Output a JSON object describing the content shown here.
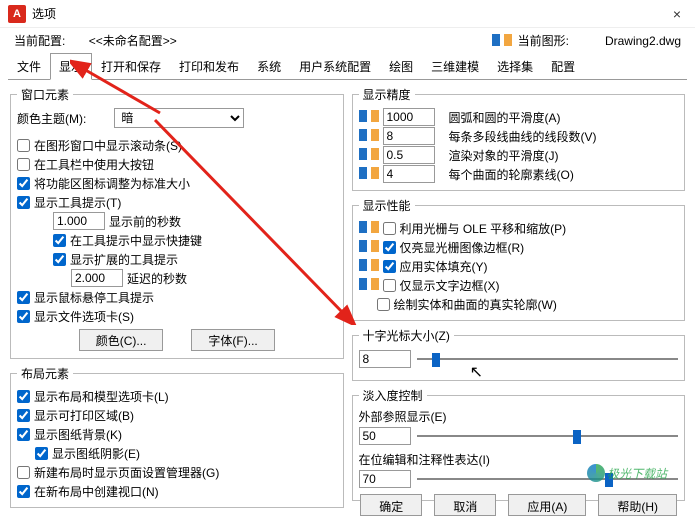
{
  "window": {
    "title": "选项",
    "close": "×"
  },
  "header": {
    "currentProfileLabel": "当前配置:",
    "currentProfileValue": "<<未命名配置>>",
    "currentDrawingLabel": "当前图形:",
    "currentDrawingValue": "Drawing2.dwg"
  },
  "tabs": [
    "文件",
    "显示",
    "打开和保存",
    "打印和发布",
    "系统",
    "用户系统配置",
    "绘图",
    "三维建模",
    "选择集",
    "配置"
  ],
  "activeTab": 1,
  "left": {
    "group1": {
      "legend": "窗口元素",
      "colorThemeLabel": "颜色主题(M):",
      "colorThemeValue": "暗",
      "items": {
        "a": "在图形窗口中显示滚动条(S)",
        "b": "在工具栏中使用大按钮",
        "c": "将功能区图标调整为标准大小",
        "d": "显示工具提示(T)",
        "d_secLabel": "显示前的秒数",
        "d_secValue": "1.000",
        "e": "在工具提示中显示快捷键",
        "f": "显示扩展的工具提示",
        "f_delayValue": "2.000",
        "f_delayLabel": "延迟的秒数",
        "g": "显示鼠标悬停工具提示",
        "h": "显示文件选项卡(S)"
      },
      "btnColor": "颜色(C)...",
      "btnFont": "字体(F)..."
    },
    "group2": {
      "legend": "布局元素",
      "items": {
        "a": "显示布局和模型选项卡(L)",
        "b": "显示可打印区域(B)",
        "c": "显示图纸背景(K)",
        "d": "显示图纸阴影(E)",
        "e": "新建布局时显示页面设置管理器(G)",
        "f": "在新布局中创建视口(N)"
      }
    }
  },
  "right": {
    "group1": {
      "legend": "显示精度",
      "rows": [
        {
          "value": "1000",
          "label": "圆弧和圆的平滑度(A)"
        },
        {
          "value": "8",
          "label": "每条多段线曲线的线段数(V)"
        },
        {
          "value": "0.5",
          "label": "渲染对象的平滑度(J)"
        },
        {
          "value": "4",
          "label": "每个曲面的轮廓素线(O)"
        }
      ]
    },
    "group2": {
      "legend": "显示性能",
      "items": {
        "a": "利用光栅与 OLE 平移和缩放(P)",
        "b": "仅亮显光栅图像边框(R)",
        "c": "应用实体填充(Y)",
        "d": "仅显示文字边框(X)",
        "e": "绘制实体和曲面的真实轮廓(W)"
      }
    },
    "group3": {
      "legend": "十字光标大小(Z)",
      "value": "8",
      "sliderPos": 6
    },
    "group4": {
      "legend": "淡入度控制",
      "row1Label": "外部参照显示(E)",
      "row1Value": "50",
      "row1Pos": 60,
      "row2Label": "在位编辑和注释性表达(I)",
      "row2Value": "70",
      "row2Pos": 72
    }
  },
  "footer": {
    "ok": "确定",
    "cancel": "取消",
    "apply": "应用(A)",
    "help": "帮助(H)"
  },
  "watermark": "极光下载站"
}
